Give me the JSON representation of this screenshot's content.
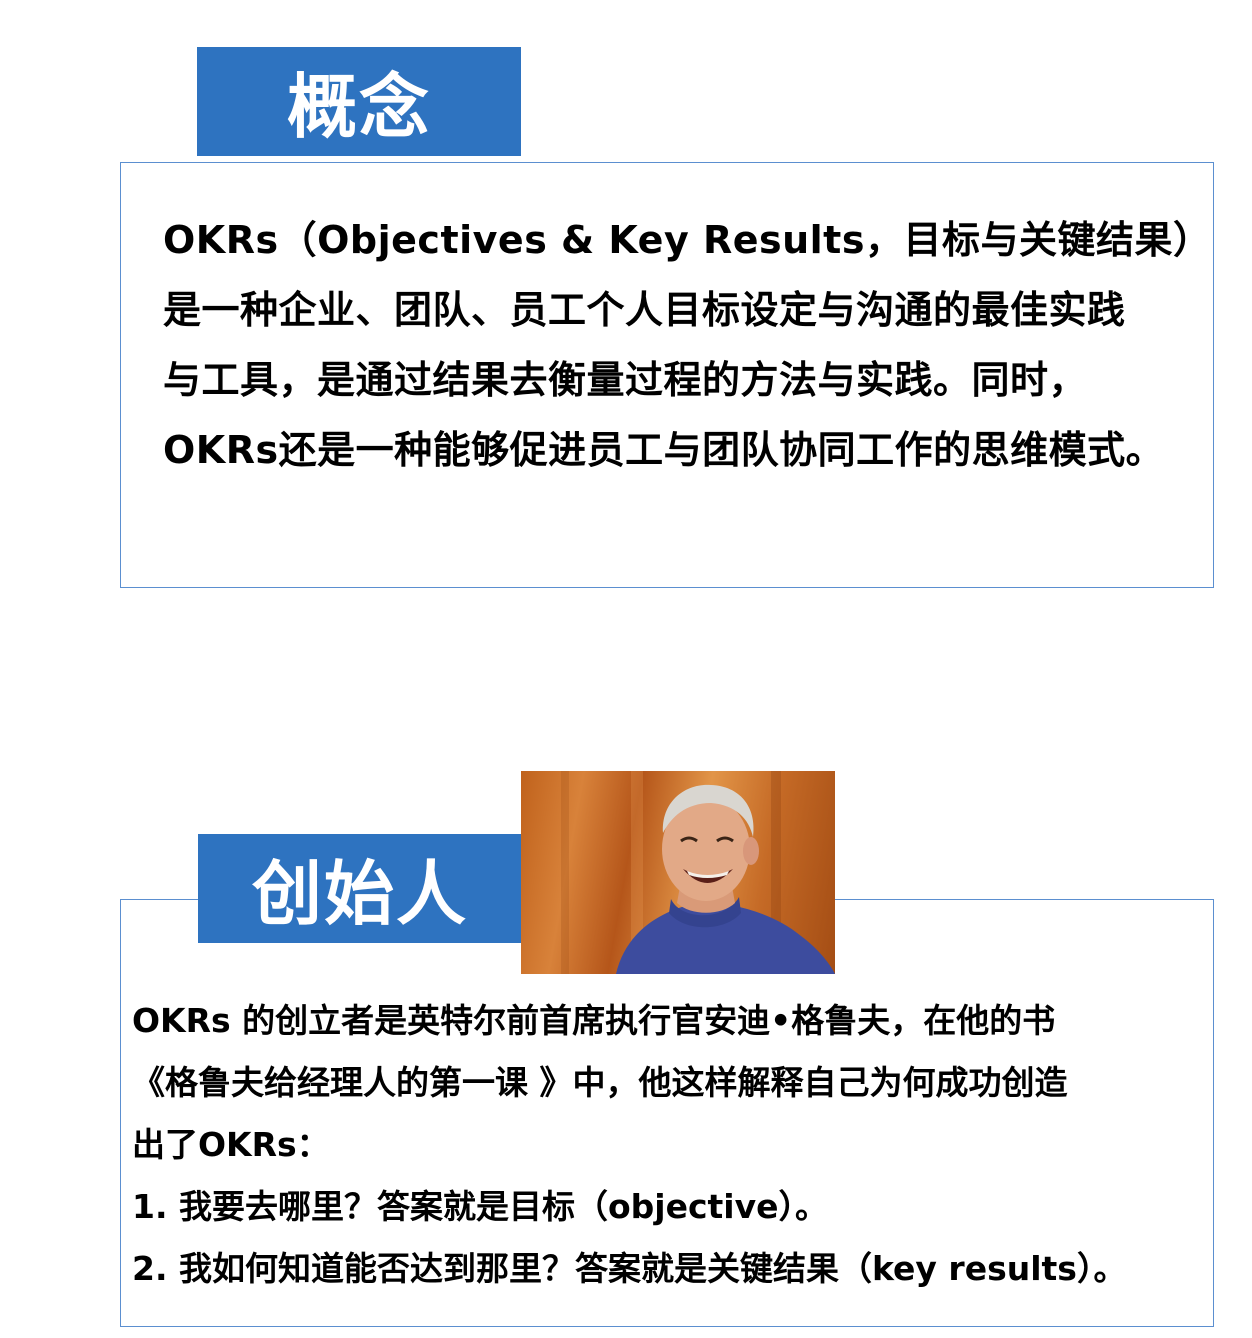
{
  "concept": {
    "label": "概念",
    "lines": [
      "OKRs（Objectives & Key Results，目标与关键结果）",
      "是一种企业、团队、员工个人目标设定与沟通的最佳实践",
      "与工具，是通过结果去衡量过程的方法与实践。同时，",
      "OKRs还是一种能够促进员工与团队协同工作的思维模式。"
    ]
  },
  "founder": {
    "label": "创始人",
    "portrait_icon": "person-portrait",
    "lines": [
      "OKRs 的创立者是英特尔前首席执行官安迪•格鲁夫，在他的书",
      "《格鲁夫给经理人的第一课 》中，他这样解释自己为何成功创造",
      "出了OKRs：",
      "1. 我要去哪里？答案就是目标（objective）。",
      "2. 我如何知道能否达到那里？答案就是关键结果（key results）。"
    ]
  },
  "colors": {
    "label_bg": "#2e73c0",
    "box_border": "#5b8fd0"
  }
}
